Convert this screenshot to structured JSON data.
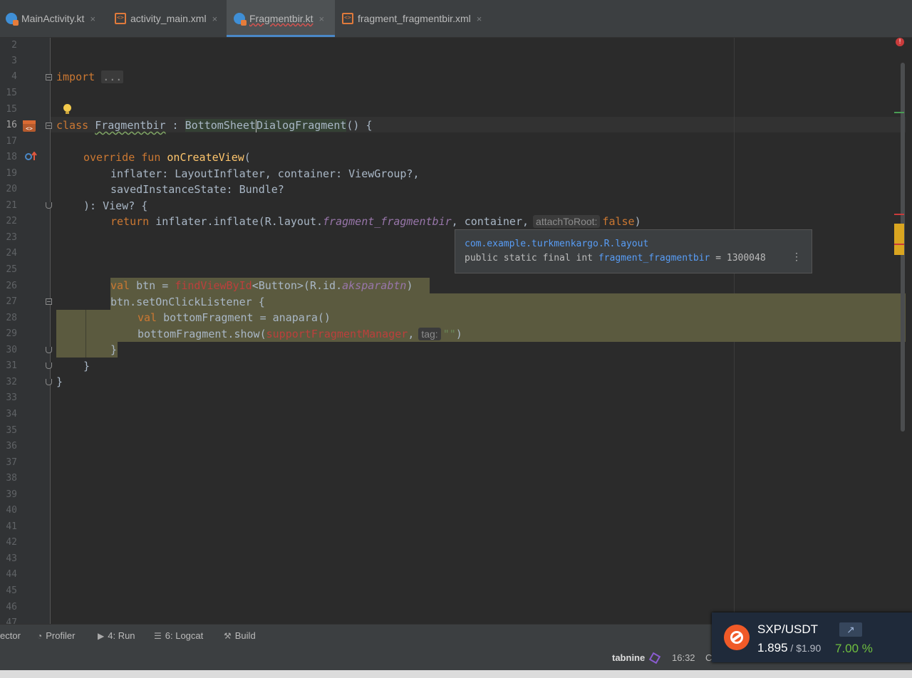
{
  "tabs": [
    {
      "label": "MainActivity.kt",
      "icon": "kotlin-file-icon"
    },
    {
      "label": "activity_main.xml",
      "icon": "xml-file-icon"
    },
    {
      "label": "Fragmentbir.kt",
      "icon": "kotlin-file-icon",
      "active": true
    },
    {
      "label": "fragment_fragmentbir.xml",
      "icon": "xml-file-icon"
    }
  ],
  "close_glyph": "×",
  "line_numbers": [
    "2",
    "3",
    "4",
    "15",
    "16",
    "17",
    "18",
    "19",
    "20",
    "21",
    "22",
    "23",
    "24",
    "25",
    "26",
    "27",
    "28",
    "29",
    "30",
    "31",
    "32",
    "33",
    "34",
    "35",
    "36",
    "37",
    "38",
    "39",
    "40",
    "41",
    "42",
    "43",
    "44",
    "45",
    "46",
    "47"
  ],
  "code": {
    "l4_import": "import",
    "l4_dots": "...",
    "l16_class": "class",
    "l16_name": "Fragmentbir",
    "l16_colon": " : ",
    "l16_base_a": "BottomSheet",
    "l16_base_b": "DialogFragment",
    "l16_rest": "() {",
    "l18_override": "override fun ",
    "l18_fn": "onCreateView",
    "l18_paren": "(",
    "l19": "inflater: LayoutInflater, container: ViewGroup?,",
    "l20": "savedInstanceState: Bundle?",
    "l21": "): View? {",
    "l22_return": "return",
    "l22_a": " inflater.inflate(R.layout.",
    "l22_it": "fragment_fragmentbir",
    "l22_b": ", container,",
    "l22_hint": "attachToRoot:",
    "l22_false": "false",
    "l22_close": ")",
    "l26_val": "val",
    "l26_a": " btn = ",
    "l26_red": "findViewById",
    "l26_b": "<Button>(R.id.",
    "l26_it": "aksparabtn",
    "l26_c": ")",
    "l27": "btn.setOnClickListener {",
    "l28_val": "val",
    "l28_a": " bottomFragment = anapara()",
    "l29_a": "bottomFragment.show(",
    "l29_red": "supportFragmentManager",
    "l29_comma": ",",
    "l29_hint": "tag:",
    "l29_str": "\"\"",
    "l29_close": ")",
    "l30": "}",
    "l31": "}",
    "l32": "}"
  },
  "tooltip": {
    "line1": "com.example.turkmenkargo.R.layout",
    "line2_pre": "public static final int ",
    "line2_field": "fragment_fragmentbir",
    "line2_post": " = 1300048",
    "more": "⋮"
  },
  "toolwindows": [
    {
      "label": "ector"
    },
    {
      "label": "Profiler",
      "icon": "profiler-icon"
    },
    {
      "label": "4: Run",
      "icon": "run-icon"
    },
    {
      "label": "6: Logcat",
      "icon": "logcat-icon"
    },
    {
      "label": "Build",
      "icon": "build-icon"
    }
  ],
  "status": {
    "plugin": "tabnine",
    "time": "16:32",
    "cut": "C"
  },
  "widget": {
    "pair": "SXP/USDT",
    "price": "1.895",
    "sep": " / ",
    "usd": "$1.90",
    "change": "7.00 %"
  },
  "colors": {
    "accent": "#4a88c7",
    "highlight": "#5b5a3f",
    "error": "#c93b3b",
    "positive": "#6fbf3f"
  }
}
